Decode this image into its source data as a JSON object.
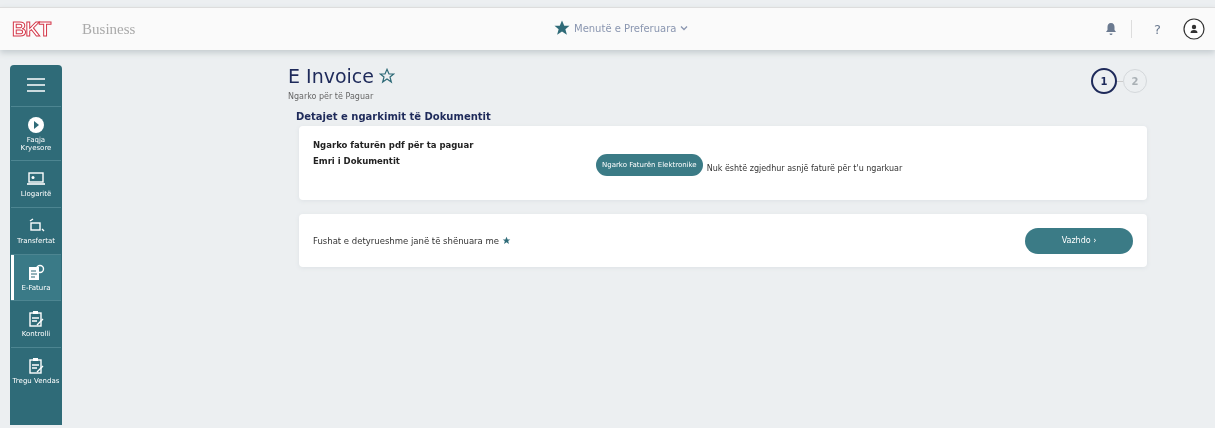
{
  "header": {
    "logo": "BKT",
    "product": "Business",
    "favorites": "Menutë e Preferuara",
    "help": "?"
  },
  "sidebar": {
    "items": [
      {
        "label": "Faqja Kryesore",
        "kind": "home",
        "selected": false
      },
      {
        "label": "Llogaritë",
        "kind": "accounts",
        "selected": false
      },
      {
        "label": "Transfertat",
        "kind": "transfer",
        "selected": false
      },
      {
        "label": "E-Fatura",
        "kind": "invoice",
        "selected": true
      },
      {
        "label": "Kontrolli",
        "kind": "clipboard",
        "selected": false
      },
      {
        "label": "Tregu Vendas",
        "kind": "clipboard",
        "selected": false
      }
    ]
  },
  "page": {
    "title": "E Invoice",
    "subtitle": "Ngarko për të Paguar",
    "steps": [
      {
        "label": "1",
        "selected": true
      },
      {
        "label": "2",
        "selected": false
      }
    ],
    "section_title": "Detajet e ngarkimit të Dokumentit",
    "upload_card": {
      "heading": "Ngarko faturën pdf për ta paguar",
      "field_label": "Emri i Dokumentit",
      "button": "Ngarko Faturën Elektronike",
      "status": "Nuk është zgjedhur asnjë faturë për t'u ngarkuar"
    },
    "footer_card": {
      "note": "Fushat e detyrueshme janë të shënuara me",
      "continue": "Vazhdo ›"
    }
  }
}
